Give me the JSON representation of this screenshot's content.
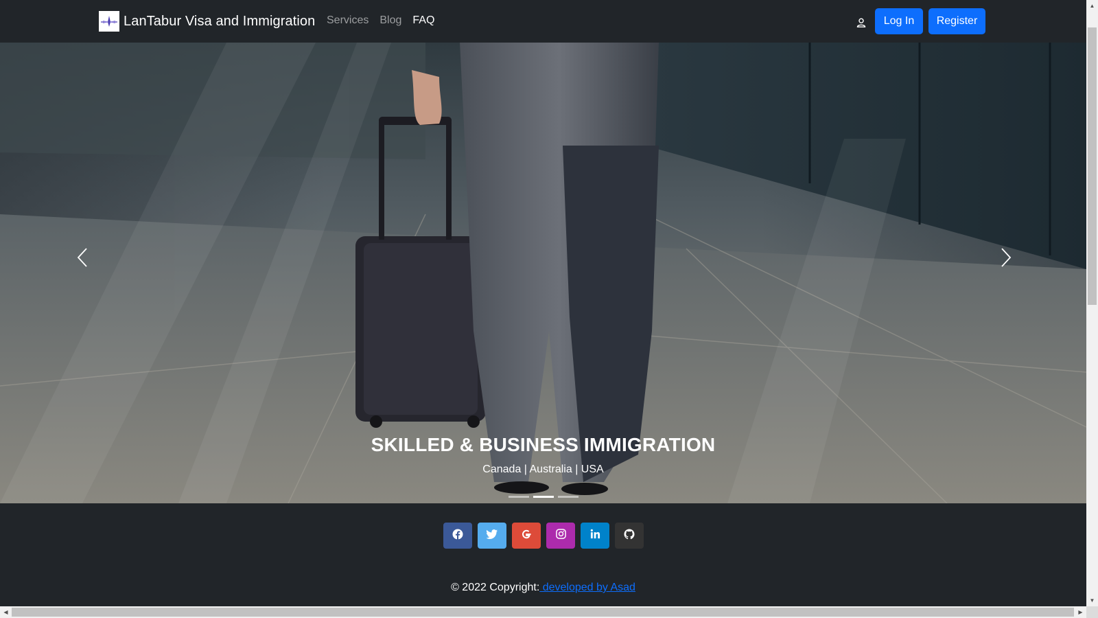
{
  "brand": {
    "name": "LanTabur Visa and Immigration",
    "logo_icon": "plane-logo-icon"
  },
  "nav": {
    "links": [
      {
        "label": "Services",
        "active": false
      },
      {
        "label": "Blog",
        "active": false
      },
      {
        "label": "FAQ",
        "active": true
      }
    ],
    "user_icon": "user-icon",
    "login_label": "Log In",
    "register_label": "Register"
  },
  "hero": {
    "title": "SKILLED & BUSINESS IMMIGRATION",
    "subtitle": "Canada | Australia | USA",
    "active_slide": 2,
    "slide_count": 3,
    "prev_icon": "chevron-left-icon",
    "next_icon": "chevron-right-icon"
  },
  "footer": {
    "social": [
      {
        "name": "facebook",
        "color": "#3b5998"
      },
      {
        "name": "twitter",
        "color": "#55acee"
      },
      {
        "name": "google",
        "color": "#dd4b39"
      },
      {
        "name": "instagram",
        "color": "#ac2bac"
      },
      {
        "name": "linkedin",
        "color": "#0082ca"
      },
      {
        "name": "github",
        "color": "#333333"
      }
    ],
    "copyright_text": "© 2022 Copyright:",
    "copyright_link": " developed by Asad"
  },
  "colors": {
    "primary": "#0d6efd",
    "dark": "#212529"
  }
}
